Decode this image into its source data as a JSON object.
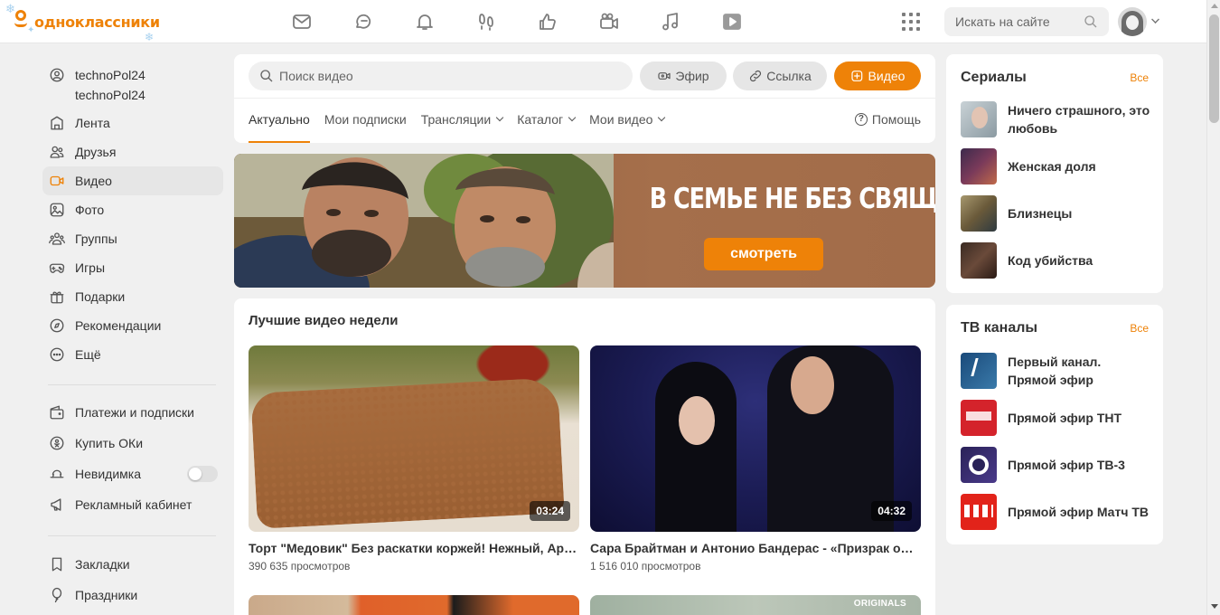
{
  "brand": {
    "name": "одноклассники",
    "accent": "#ee8208"
  },
  "header": {
    "nav_icons": [
      "mail-icon",
      "chat-icon",
      "bell-icon",
      "footprints-icon",
      "like-icon",
      "videocam-icon",
      "music-icon",
      "play-icon"
    ],
    "search_placeholder": "Искать на сайте"
  },
  "sidebar": {
    "user": {
      "name": "technoPol24",
      "login": "technoPol24"
    },
    "items": [
      {
        "label": "Лента",
        "icon": "feed-icon"
      },
      {
        "label": "Друзья",
        "icon": "friends-icon"
      },
      {
        "label": "Видео",
        "icon": "video-icon",
        "active": true
      },
      {
        "label": "Фото",
        "icon": "photo-icon"
      },
      {
        "label": "Группы",
        "icon": "groups-icon"
      },
      {
        "label": "Игры",
        "icon": "gamepad-icon"
      },
      {
        "label": "Подарки",
        "icon": "gift-icon"
      },
      {
        "label": "Рекомендации",
        "icon": "compass-icon"
      },
      {
        "label": "Ещё",
        "icon": "more-icon"
      }
    ],
    "items2": [
      {
        "label": "Платежи и подписки",
        "icon": "wallet-icon"
      },
      {
        "label": "Купить ОКи",
        "icon": "coin-icon"
      },
      {
        "label": "Невидимка",
        "icon": "incognito-icon",
        "toggle": false
      },
      {
        "label": "Рекламный кабинет",
        "icon": "megaphone-icon"
      }
    ],
    "items3": [
      {
        "label": "Закладки",
        "icon": "bookmark-icon"
      },
      {
        "label": "Праздники",
        "icon": "balloon-icon"
      }
    ]
  },
  "video": {
    "search_placeholder": "Поиск видео",
    "btn_live": "Эфир",
    "btn_link": "Ссылка",
    "btn_upload": "Видео",
    "tabs": [
      {
        "label": "Актуально",
        "active": true
      },
      {
        "label": "Мои подписки"
      },
      {
        "label": "Трансляции",
        "dropdown": true
      },
      {
        "label": "Каталог",
        "dropdown": true
      },
      {
        "label": "Мои видео",
        "dropdown": true
      }
    ],
    "help": "Помощь"
  },
  "banner": {
    "title": "В СЕМЬЕ НЕ БЕЗ СВЯЩЕННИКА",
    "button": "смотреть"
  },
  "best": {
    "title": "Лучшие видео недели",
    "videos": [
      {
        "title": "Торт \"Медовик\" Без раскатки коржей! Нежный, Ароматный и Вкусный!",
        "views": "390 635 просмотров",
        "duration": "03:24"
      },
      {
        "title": "Сара Брайтман и Антонио Бандерас - «Призрак оперы»",
        "views": "1 516 010 просмотров",
        "duration": "04:32"
      }
    ],
    "next_badge": "ORIGINALS"
  },
  "serials": {
    "title": "Сериалы",
    "all": "Все",
    "items": [
      "Ничего страшного, это любовь",
      "Женская доля",
      "Близнецы",
      "Код убийства"
    ]
  },
  "tv": {
    "title": "ТВ каналы",
    "all": "Все",
    "items": [
      "Первый канал. Прямой эфир",
      "Прямой эфир ТНТ",
      "Прямой эфир ТВ-3",
      "Прямой эфир Матч ТВ"
    ]
  }
}
